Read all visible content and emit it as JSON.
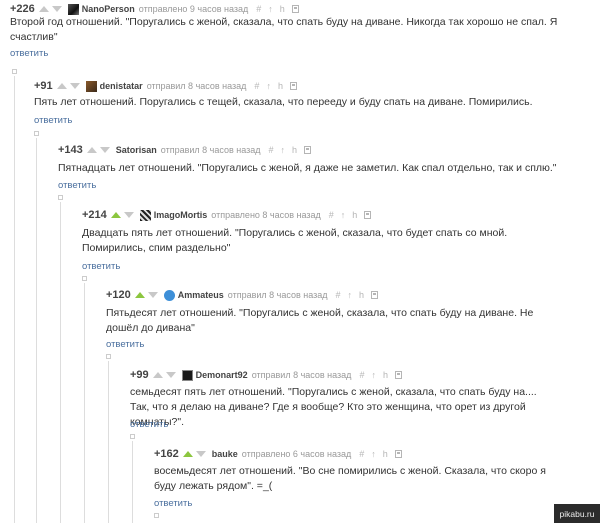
{
  "comments": [
    {
      "rating": "+226",
      "user": "NanoPerson",
      "meta": "отправлено 9 часов назад",
      "body": "Второй год отношений. \"Поругались с женой, сказала, что спать буду на диване. Никогда так хорошо не спал. Я счастлив\"",
      "reply": "ответить",
      "upvoted": false
    },
    {
      "rating": "+91",
      "user": "denistatar",
      "meta": "отправил 8 часов назад",
      "body": "Пять лет отношений. Поругались с тещей, сказала, что перееду и буду спать на диване. Помирились.",
      "reply": "ответить",
      "upvoted": false
    },
    {
      "rating": "+143",
      "user": "Satorisan",
      "meta": "отправил 8 часов назад",
      "body": "Пятнадцать лет отношений. \"Поругались с женой, я даже не заметил. Как спал отдельно, так и сплю.\"",
      "reply": "ответить",
      "upvoted": false
    },
    {
      "rating": "+214",
      "user": "ImagoMortis",
      "meta": "отправлено 8 часов назад",
      "body": "Двадцать пять лет отношений. \"Поругались с женой, сказала, что будет спать со мной. Помирились, спим раздельно\"",
      "reply": "ответить",
      "upvoted": true
    },
    {
      "rating": "+120",
      "user": "Ammateus",
      "meta": "отправил 8 часов назад",
      "body": "Пятьдесят лет отношений. \"Поругались с женой, сказала, что спать буду на диване. Не дошёл до дивана\"",
      "reply": "ответить",
      "upvoted": true
    },
    {
      "rating": "+99",
      "user": "Demonart92",
      "meta": "отправил 8 часов назад",
      "body": "семьдесят пять лет отношений. \"Поругались с женой, сказала, что спать буду на.... Так, что я делаю на диване? Где я вообще? Кто это женщина, что орет из другой комнаты?\".",
      "reply": "ответить",
      "upvoted": false
    },
    {
      "rating": "+162",
      "user": "bauke",
      "meta": "отправлено 6 часов назад",
      "body": "восемьдесят лет отношений. \"Во сне помирились с женой. Сказала, что скоро я буду лежать рядом\". =_(",
      "reply": "ответить",
      "upvoted": true
    }
  ],
  "tool_icons": [
    "hash-icon",
    "arrow-up-icon",
    "flag-icon",
    "save-icon"
  ],
  "tools": {
    "hash": "#",
    "arrow": "↑",
    "flag": "h"
  },
  "watermark": "pikabu.ru",
  "colors": {
    "upvote_active": "#8cc63f",
    "link": "#4a6f9e",
    "text": "#333333",
    "meta": "#999999"
  }
}
